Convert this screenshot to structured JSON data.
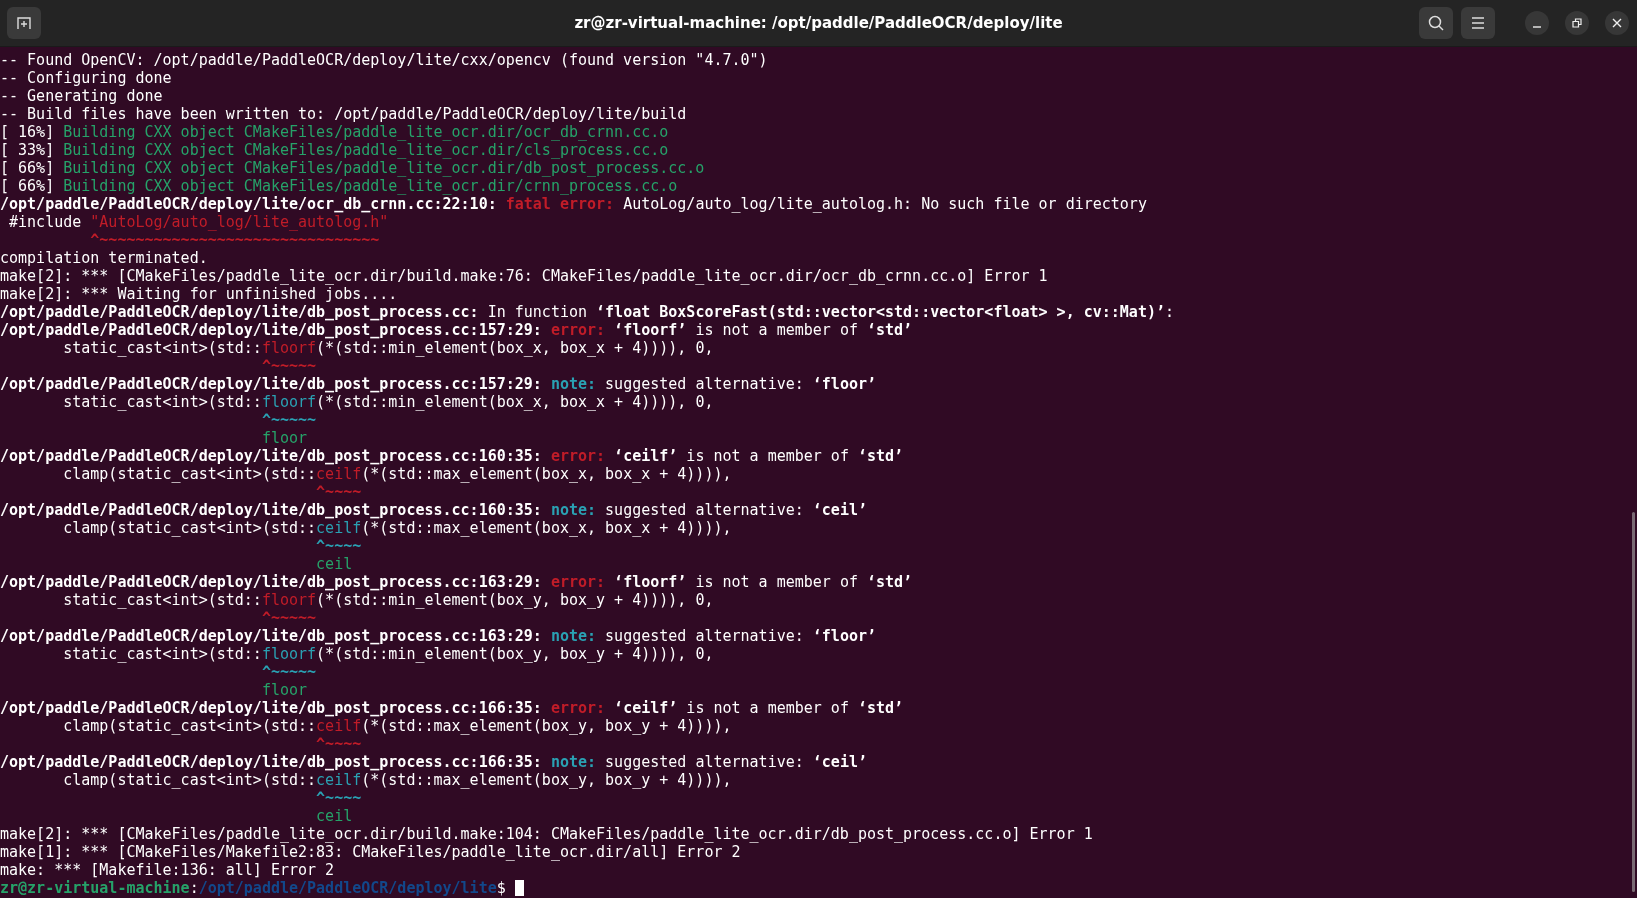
{
  "window": {
    "title": "zr@zr-virtual-machine: /opt/paddle/PaddleOCR/deploy/lite"
  },
  "terminal": {
    "lines": [
      [
        {
          "kind": "plain",
          "text": "-- Found OpenCV: /opt/paddle/PaddleOCR/deploy/lite/cxx/opencv (found version \"4.7.0\")"
        }
      ],
      [
        {
          "kind": "plain",
          "text": "-- Configuring done"
        }
      ],
      [
        {
          "kind": "plain",
          "text": "-- Generating done"
        }
      ],
      [
        {
          "kind": "plain",
          "text": "-- Build files have been written to: /opt/paddle/PaddleOCR/deploy/lite/build"
        }
      ],
      [
        {
          "kind": "plain",
          "text": "[ 16%] "
        },
        {
          "kind": "green",
          "text": "Building CXX object CMakeFiles/paddle_lite_ocr.dir/ocr_db_crnn.cc.o"
        }
      ],
      [
        {
          "kind": "plain",
          "text": "[ 33%] "
        },
        {
          "kind": "green",
          "text": "Building CXX object CMakeFiles/paddle_lite_ocr.dir/cls_process.cc.o"
        }
      ],
      [
        {
          "kind": "plain",
          "text": "[ 66%] "
        },
        {
          "kind": "green",
          "text": "Building CXX object CMakeFiles/paddle_lite_ocr.dir/db_post_process.cc.o"
        }
      ],
      [
        {
          "kind": "plain",
          "text": "[ 66%] "
        },
        {
          "kind": "green",
          "text": "Building CXX object CMakeFiles/paddle_lite_ocr.dir/crnn_process.cc.o"
        }
      ],
      [
        {
          "kind": "bold",
          "text": "/opt/paddle/PaddleOCR/deploy/lite/ocr_db_crnn.cc:22:10: "
        },
        {
          "kind": "error",
          "text": "fatal error: "
        },
        {
          "kind": "plain",
          "text": "AutoLog/auto_log/lite_autolog.h: No such file or directory"
        }
      ],
      [
        {
          "kind": "plain",
          "text": " #include "
        },
        {
          "kind": "red",
          "text": "\"AutoLog/auto_log/lite_autolog.h\""
        }
      ],
      [
        {
          "kind": "error",
          "text": "          ^~~~~~~~~~~~~~~~~~~~~~~~~~~~~~~~"
        }
      ],
      [
        {
          "kind": "plain",
          "text": "compilation terminated."
        }
      ],
      [
        {
          "kind": "plain",
          "text": "make[2]: *** [CMakeFiles/paddle_lite_ocr.dir/build.make:76: CMakeFiles/paddle_lite_ocr.dir/ocr_db_crnn.cc.o] Error 1"
        }
      ],
      [
        {
          "kind": "plain",
          "text": "make[2]: *** Waiting for unfinished jobs...."
        }
      ],
      [
        {
          "kind": "bold",
          "text": "/opt/paddle/PaddleOCR/deploy/lite/db_post_process.cc:"
        },
        {
          "kind": "plain",
          "text": " In function "
        },
        {
          "kind": "bold",
          "text": "‘float BoxScoreFast(std::vector<std::vector<float> >, cv::Mat)’"
        },
        {
          "kind": "plain",
          "text": ":"
        }
      ],
      [
        {
          "kind": "bold",
          "text": "/opt/paddle/PaddleOCR/deploy/lite/db_post_process.cc:157:29: "
        },
        {
          "kind": "error",
          "text": "error: "
        },
        {
          "kind": "bold",
          "text": "‘floorf’"
        },
        {
          "kind": "plain",
          "text": " is not a member of "
        },
        {
          "kind": "bold",
          "text": "‘std’"
        }
      ],
      [
        {
          "kind": "plain",
          "text": "       static_cast<int>(std::"
        },
        {
          "kind": "red",
          "text": "floorf"
        },
        {
          "kind": "plain",
          "text": "(*(std::min_element(box_x, box_x + 4)))), 0,"
        }
      ],
      [
        {
          "kind": "error",
          "text": "                             ^~~~~~"
        }
      ],
      [
        {
          "kind": "bold",
          "text": "/opt/paddle/PaddleOCR/deploy/lite/db_post_process.cc:157:29: "
        },
        {
          "kind": "note",
          "text": "note: "
        },
        {
          "kind": "plain",
          "text": "suggested alternative: "
        },
        {
          "kind": "bold",
          "text": "‘floor’"
        }
      ],
      [
        {
          "kind": "plain",
          "text": "       static_cast<int>(std::"
        },
        {
          "kind": "cyan",
          "text": "floorf"
        },
        {
          "kind": "plain",
          "text": "(*(std::min_element(box_x, box_x + 4)))), 0,"
        }
      ],
      [
        {
          "kind": "note",
          "text": "                             ^~~~~~"
        }
      ],
      [
        {
          "kind": "green",
          "text": "                             floor"
        }
      ],
      [
        {
          "kind": "bold",
          "text": "/opt/paddle/PaddleOCR/deploy/lite/db_post_process.cc:160:35: "
        },
        {
          "kind": "error",
          "text": "error: "
        },
        {
          "kind": "bold",
          "text": "‘ceilf’"
        },
        {
          "kind": "plain",
          "text": " is not a member of "
        },
        {
          "kind": "bold",
          "text": "‘std’"
        }
      ],
      [
        {
          "kind": "plain",
          "text": "       clamp(static_cast<int>(std::"
        },
        {
          "kind": "red",
          "text": "ceilf"
        },
        {
          "kind": "plain",
          "text": "(*(std::max_element(box_x, box_x + 4)))),"
        }
      ],
      [
        {
          "kind": "error",
          "text": "                                   ^~~~~"
        }
      ],
      [
        {
          "kind": "bold",
          "text": "/opt/paddle/PaddleOCR/deploy/lite/db_post_process.cc:160:35: "
        },
        {
          "kind": "note",
          "text": "note: "
        },
        {
          "kind": "plain",
          "text": "suggested alternative: "
        },
        {
          "kind": "bold",
          "text": "‘ceil’"
        }
      ],
      [
        {
          "kind": "plain",
          "text": "       clamp(static_cast<int>(std::"
        },
        {
          "kind": "cyan",
          "text": "ceilf"
        },
        {
          "kind": "plain",
          "text": "(*(std::max_element(box_x, box_x + 4)))),"
        }
      ],
      [
        {
          "kind": "note",
          "text": "                                   ^~~~~"
        }
      ],
      [
        {
          "kind": "green",
          "text": "                                   ceil"
        }
      ],
      [
        {
          "kind": "bold",
          "text": "/opt/paddle/PaddleOCR/deploy/lite/db_post_process.cc:163:29: "
        },
        {
          "kind": "error",
          "text": "error: "
        },
        {
          "kind": "bold",
          "text": "‘floorf’"
        },
        {
          "kind": "plain",
          "text": " is not a member of "
        },
        {
          "kind": "bold",
          "text": "‘std’"
        }
      ],
      [
        {
          "kind": "plain",
          "text": "       static_cast<int>(std::"
        },
        {
          "kind": "red",
          "text": "floorf"
        },
        {
          "kind": "plain",
          "text": "(*(std::min_element(box_y, box_y + 4)))), 0,"
        }
      ],
      [
        {
          "kind": "error",
          "text": "                             ^~~~~~"
        }
      ],
      [
        {
          "kind": "bold",
          "text": "/opt/paddle/PaddleOCR/deploy/lite/db_post_process.cc:163:29: "
        },
        {
          "kind": "note",
          "text": "note: "
        },
        {
          "kind": "plain",
          "text": "suggested alternative: "
        },
        {
          "kind": "bold",
          "text": "‘floor’"
        }
      ],
      [
        {
          "kind": "plain",
          "text": "       static_cast<int>(std::"
        },
        {
          "kind": "cyan",
          "text": "floorf"
        },
        {
          "kind": "plain",
          "text": "(*(std::min_element(box_y, box_y + 4)))), 0,"
        }
      ],
      [
        {
          "kind": "note",
          "text": "                             ^~~~~~"
        }
      ],
      [
        {
          "kind": "green",
          "text": "                             floor"
        }
      ],
      [
        {
          "kind": "bold",
          "text": "/opt/paddle/PaddleOCR/deploy/lite/db_post_process.cc:166:35: "
        },
        {
          "kind": "error",
          "text": "error: "
        },
        {
          "kind": "bold",
          "text": "‘ceilf’"
        },
        {
          "kind": "plain",
          "text": " is not a member of "
        },
        {
          "kind": "bold",
          "text": "‘std’"
        }
      ],
      [
        {
          "kind": "plain",
          "text": "       clamp(static_cast<int>(std::"
        },
        {
          "kind": "red",
          "text": "ceilf"
        },
        {
          "kind": "plain",
          "text": "(*(std::max_element(box_y, box_y + 4)))),"
        }
      ],
      [
        {
          "kind": "error",
          "text": "                                   ^~~~~"
        }
      ],
      [
        {
          "kind": "bold",
          "text": "/opt/paddle/PaddleOCR/deploy/lite/db_post_process.cc:166:35: "
        },
        {
          "kind": "note",
          "text": "note: "
        },
        {
          "kind": "plain",
          "text": "suggested alternative: "
        },
        {
          "kind": "bold",
          "text": "‘ceil’"
        }
      ],
      [
        {
          "kind": "plain",
          "text": "       clamp(static_cast<int>(std::"
        },
        {
          "kind": "cyan",
          "text": "ceilf"
        },
        {
          "kind": "plain",
          "text": "(*(std::max_element(box_y, box_y + 4)))),"
        }
      ],
      [
        {
          "kind": "note",
          "text": "                                   ^~~~~"
        }
      ],
      [
        {
          "kind": "green",
          "text": "                                   ceil"
        }
      ],
      [
        {
          "kind": "plain",
          "text": "make[2]: *** [CMakeFiles/paddle_lite_ocr.dir/build.make:104: CMakeFiles/paddle_lite_ocr.dir/db_post_process.cc.o] Error 1"
        }
      ],
      [
        {
          "kind": "plain",
          "text": "make[1]: *** [CMakeFiles/Makefile2:83: CMakeFiles/paddle_lite_ocr.dir/all] Error 2"
        }
      ],
      [
        {
          "kind": "plain",
          "text": "make: *** [Makefile:136: all] Error 2"
        }
      ],
      [
        {
          "kind": "user",
          "text": "zr@zr-virtual-machine"
        },
        {
          "kind": "plain",
          "text": ":"
        },
        {
          "kind": "path",
          "text": "/opt/paddle/PaddleOCR/deploy/lite"
        },
        {
          "kind": "plain",
          "text": "$ "
        }
      ]
    ]
  }
}
